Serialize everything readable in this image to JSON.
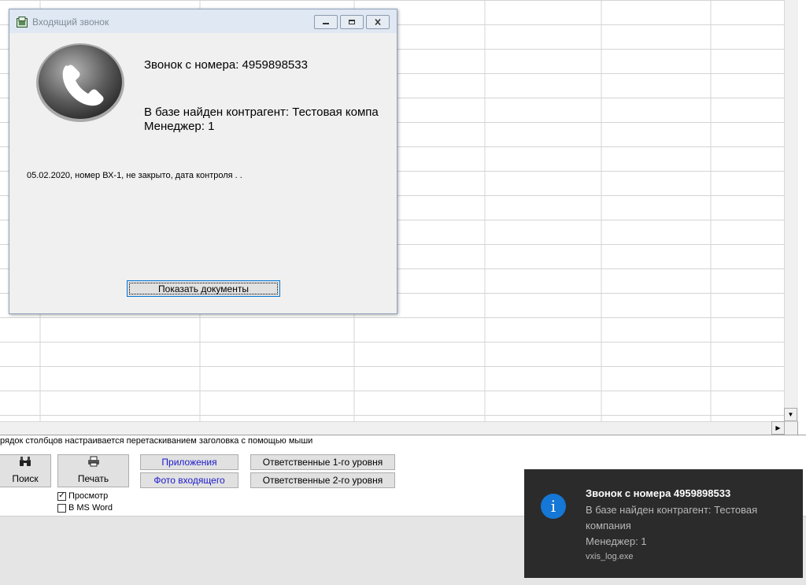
{
  "dialog": {
    "title": "Входящий звонок",
    "window_controls": [
      "minimize-icon",
      "restore-icon",
      "close-icon"
    ],
    "caller_line": "Звонок с номера: 4959898533",
    "contractor_line": "В базе найден контрагент: Тестовая компа",
    "manager_line": "Менеджер: 1",
    "record_line": "05.02.2020, номер ВХ-1, не закрыто, дата контроля   .  .",
    "show_docs_label": "Показать документы"
  },
  "grid": {
    "hint": "рядок столбцов настраивается перетаскиванием заголовка с помощью мыши"
  },
  "toolbar": {
    "search_label": "Поиск",
    "print_label": "Печать",
    "attachments_label": "Приложения",
    "incoming_photo_label": "Фото входящего",
    "responsible_lvl1_label": "Ответственные 1-го уровня",
    "responsible_lvl2_label": "Ответственные 2-го уровня",
    "preview_label": "Просмотр",
    "preview_checked": true,
    "ms_word_label": "В MS Word",
    "ms_word_checked": false
  },
  "toast": {
    "title": "Звонок с номера 4959898533",
    "body_line1": "В базе найден контрагент: Тестовая",
    "body_line2": "компания",
    "body_line3": "Менеджер: 1",
    "app_name": "vxis_log.exe",
    "icon": "info-icon",
    "accent_color": "#1577d6"
  }
}
